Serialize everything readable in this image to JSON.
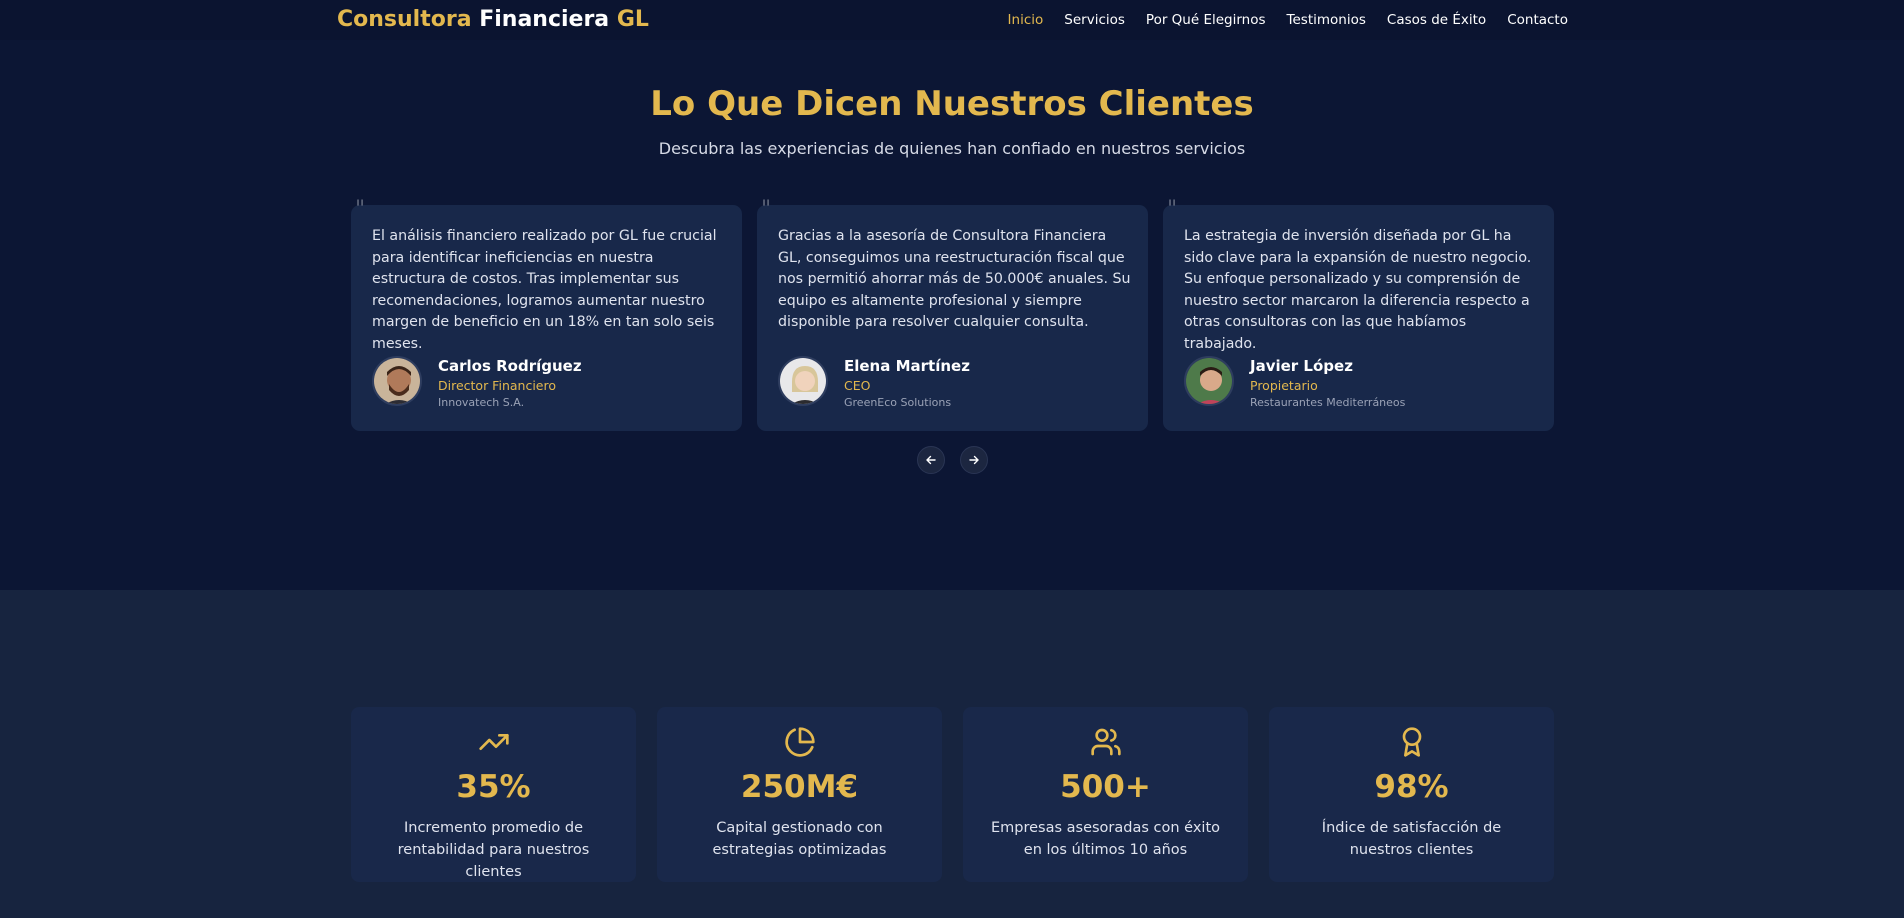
{
  "header": {
    "logo": {
      "part1": "Consultora",
      "part2": "Financiera",
      "part3": "GL"
    },
    "nav": [
      "Inicio",
      "Servicios",
      "Por Qué Elegirnos",
      "Testimonios",
      "Casos de Éxito",
      "Contacto"
    ],
    "active_nav": "Inicio"
  },
  "testimonials": {
    "title": "Lo Que Dicen Nuestros Clientes",
    "subtitle": "Descubra las experiencias de quienes han confiado en nuestros servicios",
    "items": [
      {
        "text": "El análisis financiero realizado por GL fue crucial para identificar ineficiencias en nuestra estructura de costos. Tras implementar sus recomendaciones, logramos aumentar nuestro margen de beneficio en un 18% en tan solo seis meses.",
        "name": "Carlos Rodríguez",
        "role": "Director Financiero",
        "company": "Innovatech S.A."
      },
      {
        "text": "Gracias a la asesoría de Consultora Financiera GL, conseguimos una reestructuración fiscal que nos permitió ahorrar más de 50.000€ anuales. Su equipo es altamente profesional y siempre disponible para resolver cualquier consulta.",
        "name": "Elena Martínez",
        "role": "CEO",
        "company": "GreenEco Solutions"
      },
      {
        "text": "La estrategia de inversión diseñada por GL ha sido clave para la expansión de nuestro negocio. Su enfoque personalizado y su comprensión de nuestro sector marcaron la diferencia respecto a otras consultoras con las que habíamos trabajado.",
        "name": "Javier López",
        "role": "Propietario",
        "company": "Restaurantes Mediterráneos"
      }
    ]
  },
  "stats": [
    {
      "icon": "trending-up-icon",
      "value": "35%",
      "desc": "Incremento promedio de rentabilidad para nuestros clientes"
    },
    {
      "icon": "pie-chart-icon",
      "value": "250M€",
      "desc": "Capital gestionado con estrategias optimizadas"
    },
    {
      "icon": "users-icon",
      "value": "500+",
      "desc": "Empresas asesoradas con éxito en los últimos 10 años"
    },
    {
      "icon": "award-icon",
      "value": "98%",
      "desc": "Índice de satisfacción de nuestros clientes"
    }
  ],
  "colors": {
    "accent": "#e3b84e",
    "background": "#0c1634",
    "card": "#18284a",
    "stats_bg": "#17243f"
  }
}
